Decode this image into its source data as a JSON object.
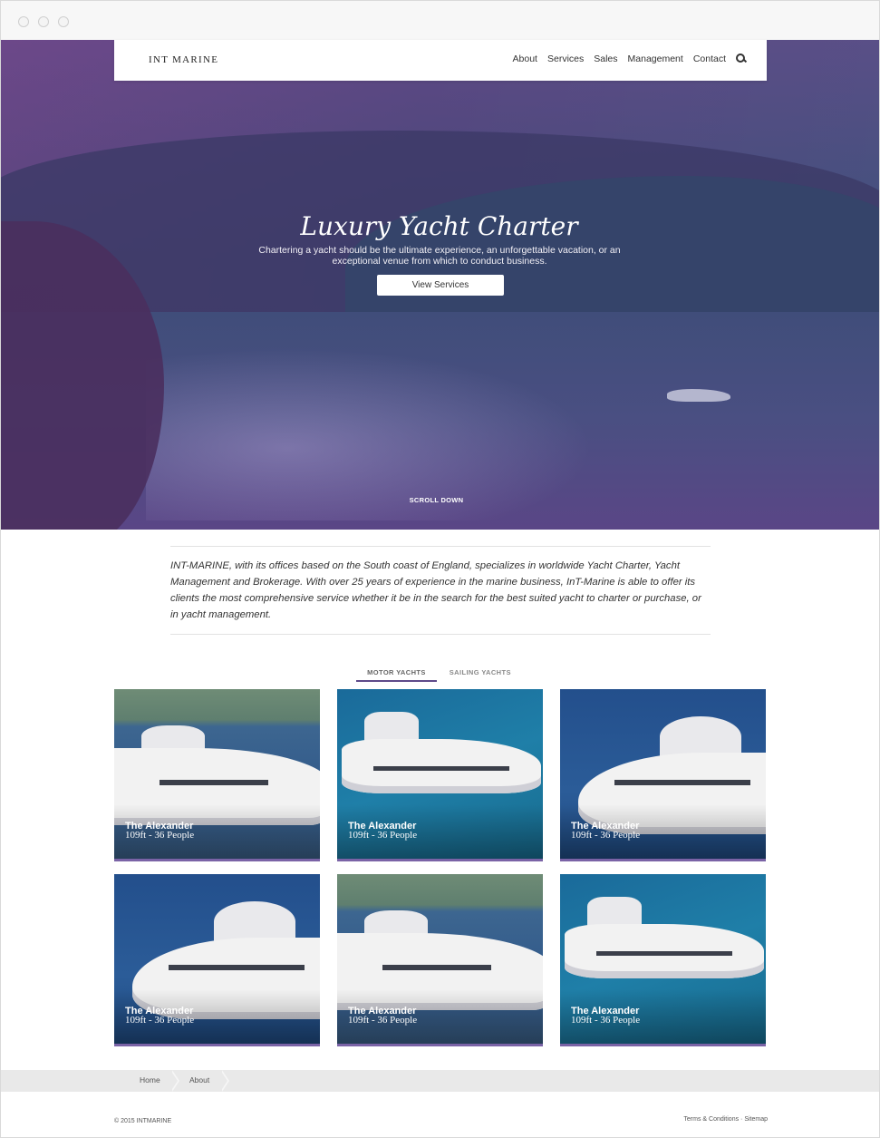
{
  "site": {
    "logo": "INT MARINE",
    "nav": [
      "About",
      "Services",
      "Sales",
      "Management",
      "Contact"
    ]
  },
  "hero": {
    "title": "Luxury Yacht Charter",
    "subtitle": "Chartering a yacht should be the ultimate experience, an unforgettable vacation, or an exceptional venue from which to conduct business.",
    "button": "View Services",
    "scroll": "SCROLL DOWN"
  },
  "intro": "INT-MARINE, with its offices based on the South coast of England, specializes in worldwide Yacht Charter, Yacht Management and Brokerage. With over 25 years of experience in the marine business, InT-Marine is able to offer its clients the most comprehensive service whether it be in the search for the best suited yacht to charter or purchase, or in yacht management.",
  "tabs": [
    "MOTOR YACHTS",
    "SAILING YACHTS"
  ],
  "yachts": [
    {
      "name": "The Alexander",
      "details": "109ft - 36 People"
    },
    {
      "name": "The Alexander",
      "details": "109ft - 36 People"
    },
    {
      "name": "The Alexander",
      "details": "109ft - 36 People"
    },
    {
      "name": "The Alexander",
      "details": "109ft - 36 People"
    },
    {
      "name": "The Alexander",
      "details": "109ft - 36 People"
    },
    {
      "name": "The Alexander",
      "details": "109ft - 36 People"
    }
  ],
  "breadcrumb": [
    "Home",
    "About"
  ],
  "footer": {
    "copyright": "© 2015 INTMARINE",
    "links": "Terms & Conditions · Sitemap"
  }
}
